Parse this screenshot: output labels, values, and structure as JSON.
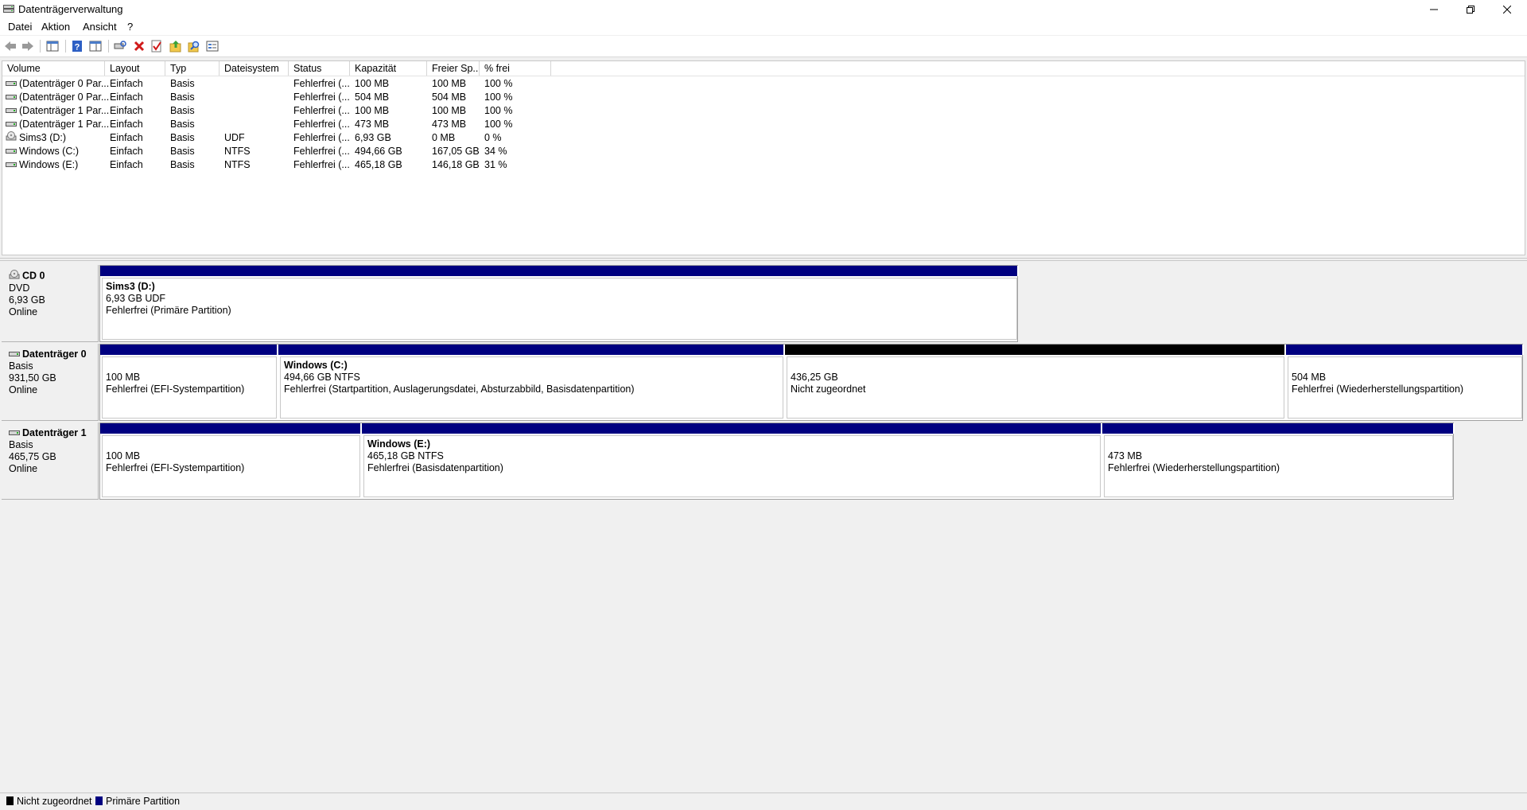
{
  "window": {
    "title": "Datenträgerverwaltung"
  },
  "menu": [
    "Datei",
    "Aktion",
    "Ansicht",
    "?"
  ],
  "toolbar_icons": [
    "back-icon",
    "forward-icon",
    "console-tree-icon",
    "help-icon",
    "properties-icon",
    "connect-icon",
    "delete-icon",
    "check-icon",
    "import-icon",
    "search-icon",
    "view-icon"
  ],
  "colors": {
    "primary": "#000080",
    "unallocated": "#000000",
    "window_bg": "#f0f0f0"
  },
  "volume_table": {
    "columns": [
      "Volume",
      "Layout",
      "Typ",
      "Dateisystem",
      "Status",
      "Kapazität",
      "Freier Sp...",
      "% frei"
    ],
    "rows": [
      {
        "icon": "disk-icon",
        "volume": "(Datenträger 0 Par...",
        "layout": "Einfach",
        "typ": "Basis",
        "fs": "",
        "status": "Fehlerfrei (...",
        "kap": "100 MB",
        "frei": "100 MB",
        "pct": "100 %"
      },
      {
        "icon": "disk-icon",
        "volume": "(Datenträger 0 Par...",
        "layout": "Einfach",
        "typ": "Basis",
        "fs": "",
        "status": "Fehlerfrei (...",
        "kap": "504 MB",
        "frei": "504 MB",
        "pct": "100 %"
      },
      {
        "icon": "disk-icon",
        "volume": "(Datenträger 1 Par...",
        "layout": "Einfach",
        "typ": "Basis",
        "fs": "",
        "status": "Fehlerfrei (...",
        "kap": "100 MB",
        "frei": "100 MB",
        "pct": "100 %"
      },
      {
        "icon": "disk-icon",
        "volume": "(Datenträger 1 Par...",
        "layout": "Einfach",
        "typ": "Basis",
        "fs": "",
        "status": "Fehlerfrei (...",
        "kap": "473 MB",
        "frei": "473 MB",
        "pct": "100 %"
      },
      {
        "icon": "cd-icon",
        "volume": "Sims3 (D:)",
        "layout": "Einfach",
        "typ": "Basis",
        "fs": "UDF",
        "status": "Fehlerfrei (...",
        "kap": "6,93 GB",
        "frei": "0 MB",
        "pct": "0 %"
      },
      {
        "icon": "disk-icon",
        "volume": "Windows (C:)",
        "layout": "Einfach",
        "typ": "Basis",
        "fs": "NTFS",
        "status": "Fehlerfrei (...",
        "kap": "494,66 GB",
        "frei": "167,05 GB",
        "pct": "34 %"
      },
      {
        "icon": "disk-icon",
        "volume": "Windows (E:)",
        "layout": "Einfach",
        "typ": "Basis",
        "fs": "NTFS",
        "status": "Fehlerfrei (...",
        "kap": "465,18 GB",
        "frei": "146,18 GB",
        "pct": "31 %"
      }
    ]
  },
  "disks": [
    {
      "icon": "cd-icon",
      "name": "CD 0",
      "type": "DVD",
      "size": "6,93 GB",
      "state": "Online",
      "partitions": [
        {
          "kind": "primary",
          "name": "Sims3  (D:)",
          "line1": "6,93 GB UDF",
          "line2": "Fehlerfrei (Primäre Partition)"
        }
      ]
    },
    {
      "icon": "disk-icon",
      "name": "Datenträger 0",
      "type": "Basis",
      "size": "931,50 GB",
      "state": "Online",
      "partitions": [
        {
          "kind": "primary",
          "name": "",
          "line1": "100 MB",
          "line2": "Fehlerfrei (EFI-Systempartition)"
        },
        {
          "kind": "primary",
          "name": "Windows  (C:)",
          "line1": "494,66 GB NTFS",
          "line2": "Fehlerfrei (Startpartition, Auslagerungsdatei, Absturzabbild, Basisdatenpartition)"
        },
        {
          "kind": "unallocated",
          "name": "",
          "line1": "436,25 GB",
          "line2": "Nicht zugeordnet"
        },
        {
          "kind": "primary",
          "name": "",
          "line1": "504 MB",
          "line2": "Fehlerfrei (Wiederherstellungspartition)"
        }
      ]
    },
    {
      "icon": "disk-icon",
      "name": "Datenträger 1",
      "type": "Basis",
      "size": "465,75 GB",
      "state": "Online",
      "partitions": [
        {
          "kind": "primary",
          "name": "",
          "line1": "100 MB",
          "line2": "Fehlerfrei (EFI-Systempartition)"
        },
        {
          "kind": "primary",
          "name": "Windows  (E:)",
          "line1": "465,18 GB NTFS",
          "line2": "Fehlerfrei (Basisdatenpartition)"
        },
        {
          "kind": "primary",
          "name": "",
          "line1": "473 MB",
          "line2": "Fehlerfrei (Wiederherstellungspartition)"
        }
      ]
    }
  ],
  "legend": [
    {
      "label": "Nicht zugeordnet",
      "color": "#000000"
    },
    {
      "label": "Primäre Partition",
      "color": "#000080"
    }
  ]
}
